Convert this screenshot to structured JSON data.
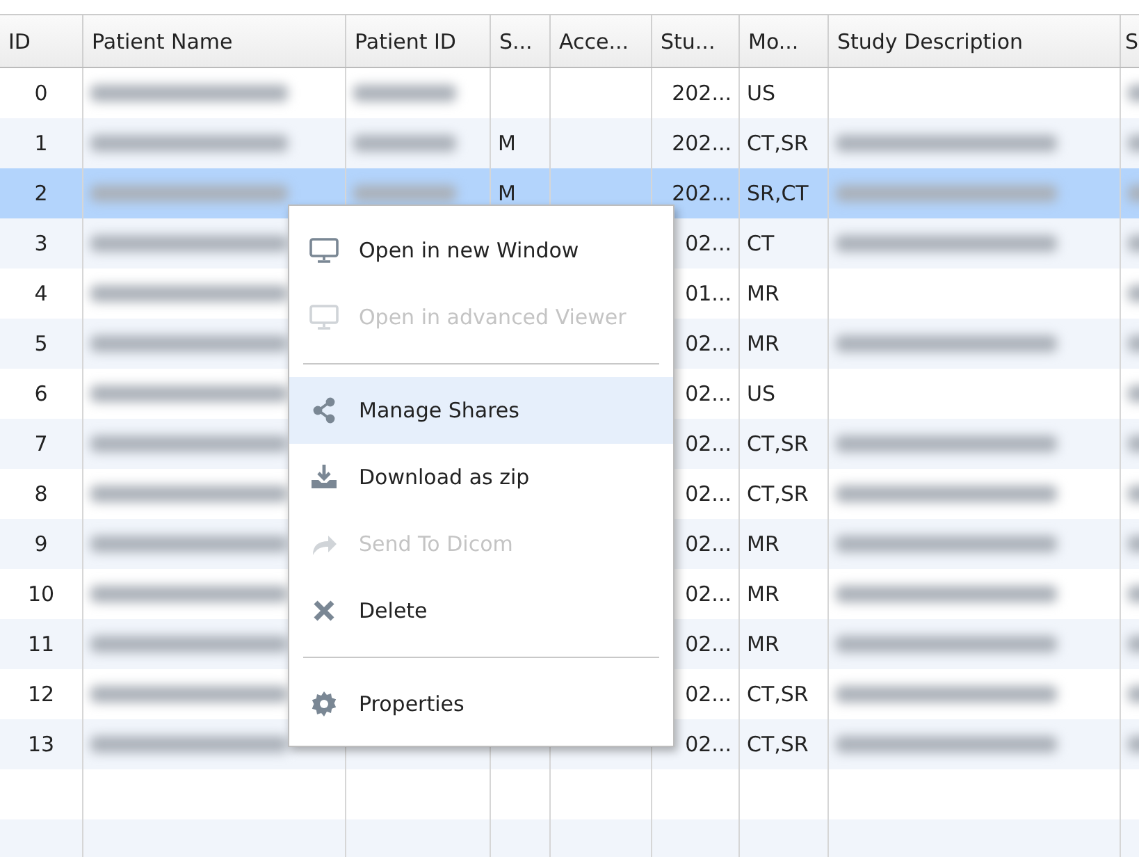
{
  "table": {
    "columns": [
      "ID",
      "Patient Name",
      "Patient ID",
      "S...",
      "Acce...",
      "Stu...",
      "Mo...",
      "Study Description",
      "S"
    ],
    "rows": [
      {
        "selected": false,
        "cells": [
          {
            "text": "0"
          },
          {
            "redacted": true
          },
          {
            "redacted": true
          },
          {},
          {},
          {
            "text": "202..."
          },
          {
            "text": "US"
          },
          {},
          {
            "redacted": true
          }
        ]
      },
      {
        "selected": false,
        "cells": [
          {
            "text": "1"
          },
          {
            "redacted": true
          },
          {
            "redacted": true
          },
          {
            "text": "M"
          },
          {},
          {
            "text": "202..."
          },
          {
            "text": "CT,SR"
          },
          {
            "redacted": true
          },
          {
            "redacted": true
          }
        ]
      },
      {
        "selected": true,
        "cells": [
          {
            "text": "2"
          },
          {
            "redacted": true
          },
          {
            "redacted": true
          },
          {
            "text": "M"
          },
          {},
          {
            "text": "202..."
          },
          {
            "text": "SR,CT"
          },
          {
            "redacted": true
          },
          {
            "redacted": true
          }
        ]
      },
      {
        "selected": false,
        "cells": [
          {
            "text": "3"
          },
          {
            "redacted": true
          },
          {},
          {},
          {},
          {
            "text": "02..."
          },
          {
            "text": "CT"
          },
          {
            "redacted": true
          },
          {
            "redacted": true
          }
        ]
      },
      {
        "selected": false,
        "cells": [
          {
            "text": "4"
          },
          {
            "redacted": true
          },
          {},
          {},
          {},
          {
            "text": "01..."
          },
          {
            "text": "MR"
          },
          {},
          {
            "redacted": true
          }
        ]
      },
      {
        "selected": false,
        "cells": [
          {
            "text": "5"
          },
          {
            "redacted": true
          },
          {},
          {},
          {},
          {
            "text": "02..."
          },
          {
            "text": "MR"
          },
          {
            "redacted": true
          },
          {
            "redacted": true
          }
        ]
      },
      {
        "selected": false,
        "cells": [
          {
            "text": "6"
          },
          {
            "redacted": true
          },
          {},
          {},
          {},
          {
            "text": "02..."
          },
          {
            "text": "US"
          },
          {},
          {
            "redacted": true
          }
        ]
      },
      {
        "selected": false,
        "cells": [
          {
            "text": "7"
          },
          {
            "redacted": true
          },
          {},
          {},
          {},
          {
            "text": "02..."
          },
          {
            "text": "CT,SR"
          },
          {
            "redacted": true
          },
          {
            "redacted": true
          }
        ]
      },
      {
        "selected": false,
        "cells": [
          {
            "text": "8"
          },
          {
            "redacted": true
          },
          {},
          {},
          {},
          {
            "text": "02..."
          },
          {
            "text": "CT,SR"
          },
          {
            "redacted": true
          },
          {
            "redacted": true
          }
        ]
      },
      {
        "selected": false,
        "cells": [
          {
            "text": "9"
          },
          {
            "redacted": true
          },
          {},
          {},
          {},
          {
            "text": "02..."
          },
          {
            "text": "MR"
          },
          {
            "redacted": true
          },
          {
            "redacted": true
          }
        ]
      },
      {
        "selected": false,
        "cells": [
          {
            "text": "10"
          },
          {
            "redacted": true
          },
          {},
          {},
          {},
          {
            "text": "02..."
          },
          {
            "text": "MR"
          },
          {
            "redacted": true
          },
          {
            "redacted": true
          }
        ]
      },
      {
        "selected": false,
        "cells": [
          {
            "text": "11"
          },
          {
            "redacted": true
          },
          {},
          {},
          {},
          {
            "text": "02..."
          },
          {
            "text": "MR"
          },
          {
            "redacted": true
          },
          {
            "redacted": true
          }
        ]
      },
      {
        "selected": false,
        "cells": [
          {
            "text": "12"
          },
          {
            "redacted": true
          },
          {},
          {},
          {},
          {
            "text": "02..."
          },
          {
            "text": "CT,SR"
          },
          {
            "redacted": true
          },
          {
            "redacted": true
          }
        ]
      },
      {
        "selected": false,
        "cells": [
          {
            "text": "13"
          },
          {
            "redacted": true
          },
          {},
          {},
          {},
          {
            "text": "02..."
          },
          {
            "text": "CT,SR"
          },
          {
            "redacted": true
          },
          {
            "redacted": true
          }
        ]
      }
    ]
  },
  "context_menu": {
    "items": [
      {
        "kind": "item",
        "label": "Open in new Window",
        "disabled": false,
        "selected": false
      },
      {
        "kind": "item",
        "label": "Open in advanced Viewer",
        "disabled": true,
        "selected": false
      },
      {
        "kind": "separator"
      },
      {
        "kind": "item",
        "label": "Manage Shares",
        "disabled": false,
        "selected": true
      },
      {
        "kind": "item",
        "label": "Download as zip",
        "disabled": false,
        "selected": false
      },
      {
        "kind": "item",
        "label": "Send To Dicom",
        "disabled": true,
        "selected": false
      },
      {
        "kind": "item",
        "label": "Delete",
        "disabled": false,
        "selected": false
      },
      {
        "kind": "separator"
      },
      {
        "kind": "item",
        "label": "Properties",
        "disabled": false,
        "selected": false
      }
    ]
  }
}
